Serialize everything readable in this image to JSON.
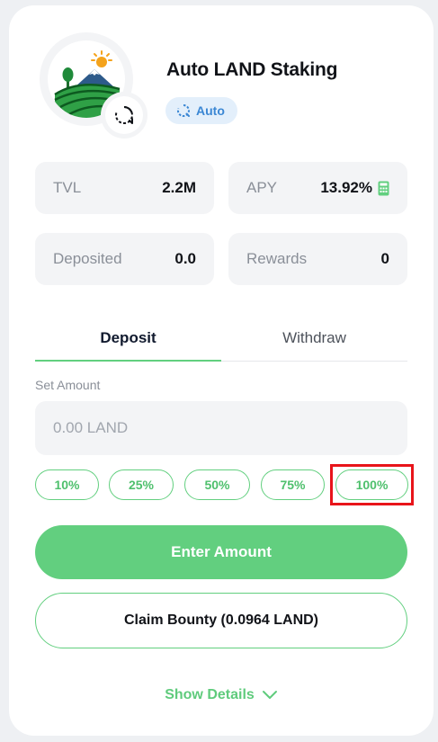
{
  "header": {
    "title": "Auto LAND Staking",
    "tag_label": "Auto",
    "logo_icon": "landscape-logo-icon",
    "badge_icon": "auto-compound-refresh-icon"
  },
  "stats": {
    "tvl": {
      "label": "TVL",
      "value": "2.2M"
    },
    "apy": {
      "label": "APY",
      "value": "13.92%",
      "icon": "calculator-icon"
    },
    "deposited": {
      "label": "Deposited",
      "value": "0.0"
    },
    "rewards": {
      "label": "Rewards",
      "value": "0"
    }
  },
  "tabs": [
    {
      "label": "Deposit",
      "active": true
    },
    {
      "label": "Withdraw",
      "active": false
    }
  ],
  "form": {
    "set_amount_label": "Set Amount",
    "amount_placeholder": "0.00 LAND",
    "percent_buttons": [
      "10%",
      "25%",
      "50%",
      "75%",
      "100%"
    ],
    "highlighted_button": "100%"
  },
  "actions": {
    "enter_amount_label": "Enter Amount",
    "claim_bounty_label": "Claim Bounty (0.0964 LAND)",
    "show_details_label": "Show Details"
  },
  "colors": {
    "accent_green": "#62cf7f",
    "tag_blue": "#3b87d4",
    "highlight_red": "#e8141a"
  }
}
